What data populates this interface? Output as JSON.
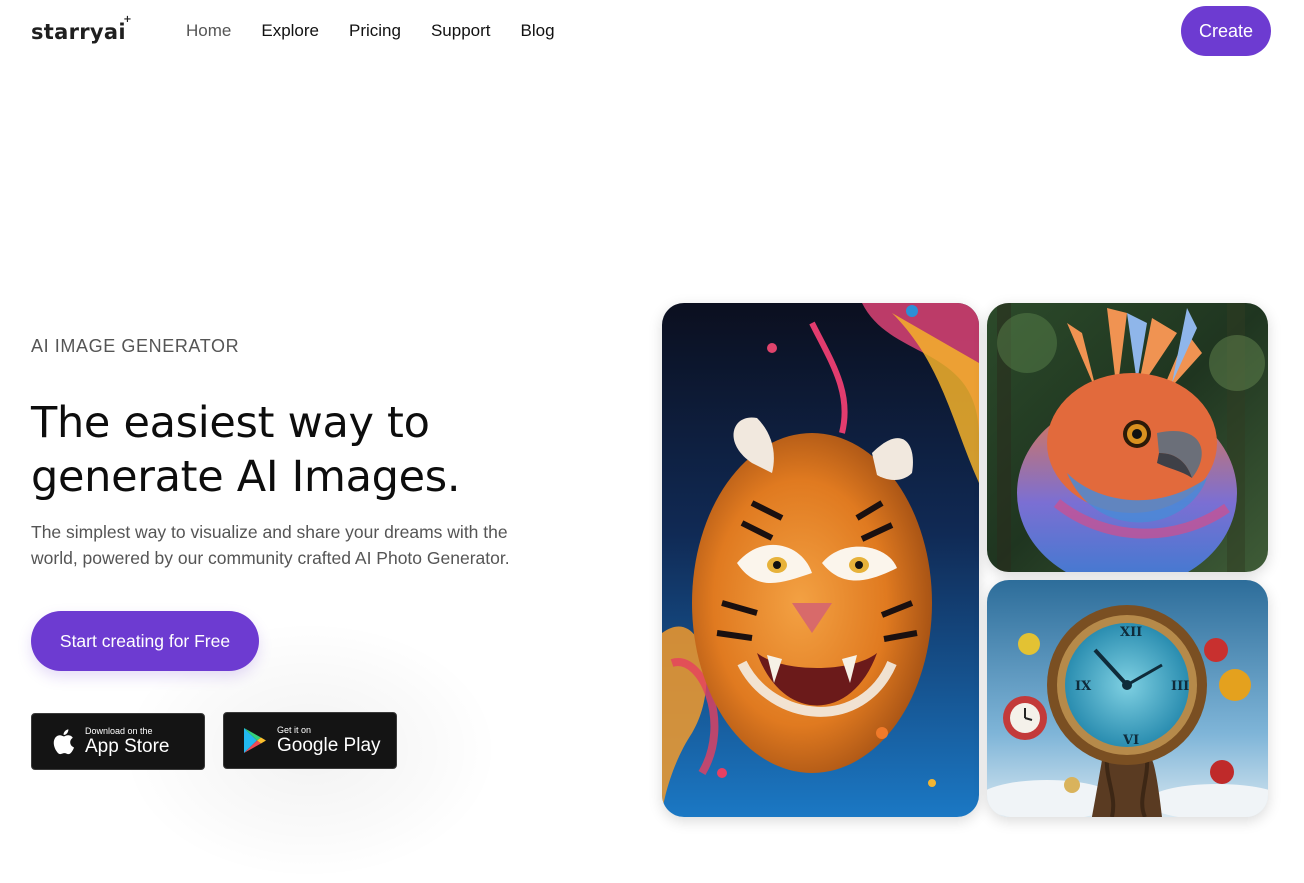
{
  "brand": {
    "logo_text": "starryai",
    "logo_spark": "+"
  },
  "nav": {
    "items": [
      {
        "label": "Home",
        "active": true
      },
      {
        "label": "Explore"
      },
      {
        "label": "Pricing"
      },
      {
        "label": "Support"
      },
      {
        "label": "Blog"
      }
    ],
    "create_label": "Create"
  },
  "hero": {
    "eyebrow": "AI IMAGE GENERATOR",
    "headline_line1": "The easiest way to",
    "headline_line2": "generate AI Images.",
    "subcopy_line1": "The simplest way to visualize and share your dreams with the",
    "subcopy_line2": "world, powered by our community crafted AI Photo Generator.",
    "cta_label": "Start creating for Free"
  },
  "stores": {
    "apple": {
      "small": "Download on the",
      "big": "App Store",
      "icon": "apple-icon"
    },
    "google": {
      "small": "Get it on",
      "big": "Google Play",
      "icon": "google-play-icon"
    }
  },
  "gallery": [
    {
      "subject": "tiger-image"
    },
    {
      "subject": "bird-image"
    },
    {
      "subject": "clock-image"
    }
  ],
  "colors": {
    "accent": "#6d3bd1",
    "text": "#111111",
    "muted": "#555555",
    "store_bg": "#141414"
  }
}
